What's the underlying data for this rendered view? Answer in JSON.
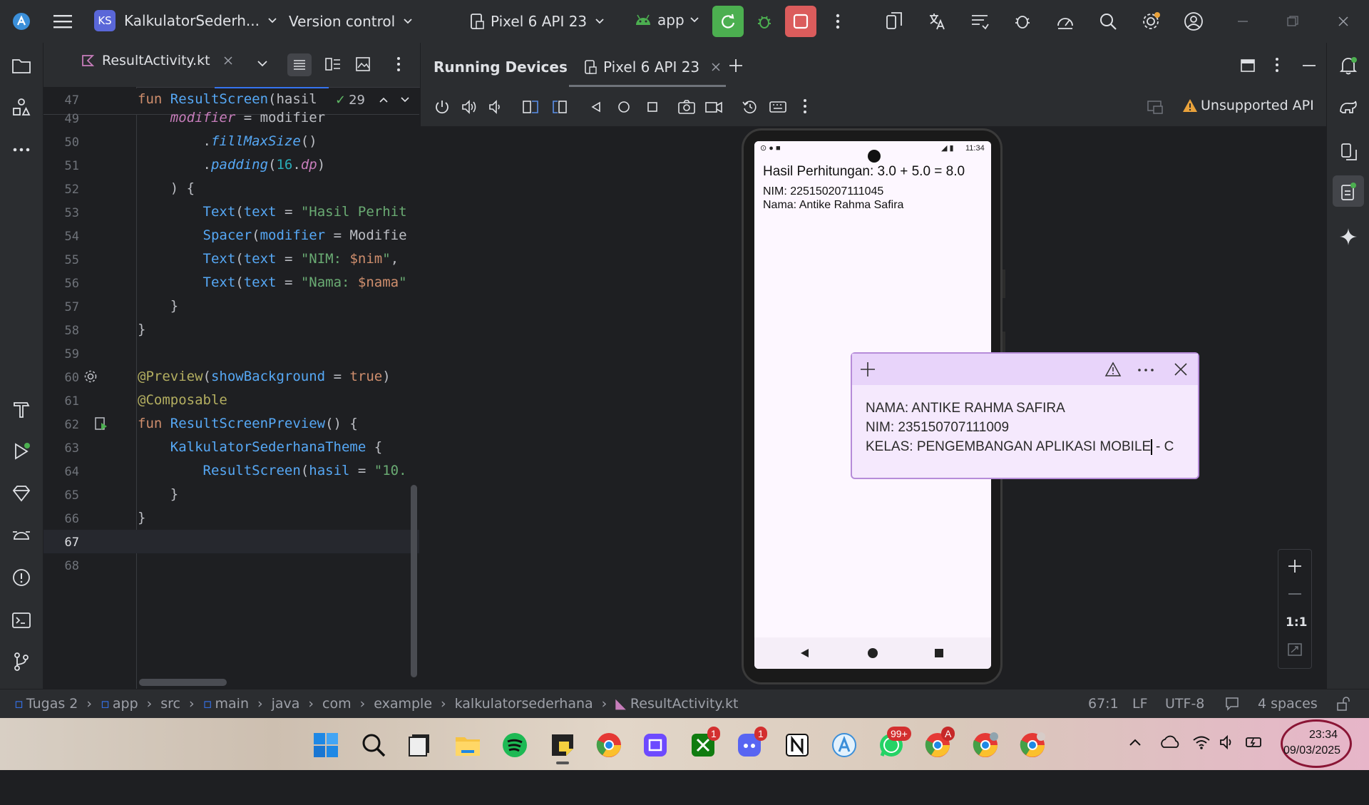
{
  "titlebar": {
    "project_initials": "KS",
    "project_name": "KalkulatorSederh...",
    "version_control": "Version control",
    "device": "Pixel 6 API 23",
    "run_config": "app"
  },
  "editor": {
    "tab_label": "ResultActivity.kt",
    "sticky_header": "fun ResultScreen(hasil",
    "hint_count": "29",
    "lines": [
      {
        "n": "47",
        "text": ""
      },
      {
        "n": "49",
        "text": "modifier = modifier"
      },
      {
        "n": "50",
        "text": ".fillMaxSize()"
      },
      {
        "n": "51",
        "text": ".padding(16.dp)"
      },
      {
        "n": "52",
        "text": ") {"
      },
      {
        "n": "53",
        "text": "Text(text = \"Hasil Perhit"
      },
      {
        "n": "54",
        "text": "Spacer(modifier = Modifie"
      },
      {
        "n": "55",
        "text": "Text(text = \"NIM: $nim\","
      },
      {
        "n": "56",
        "text": "Text(text = \"Nama: $nama\""
      },
      {
        "n": "57",
        "text": "}"
      },
      {
        "n": "58",
        "text": "}"
      },
      {
        "n": "59",
        "text": ""
      },
      {
        "n": "60",
        "text": "@Preview(showBackground = true)"
      },
      {
        "n": "61",
        "text": "@Composable"
      },
      {
        "n": "62",
        "text": "fun ResultScreenPreview() {"
      },
      {
        "n": "63",
        "text": "KalkulatorSederhanaTheme {"
      },
      {
        "n": "64",
        "text": "ResultScreen(hasil = \"10."
      },
      {
        "n": "65",
        "text": "}"
      },
      {
        "n": "66",
        "text": "}"
      },
      {
        "n": "67",
        "text": ""
      },
      {
        "n": "68",
        "text": ""
      }
    ]
  },
  "running_devices": {
    "title": "Running Devices",
    "device_tab": "Pixel 6 API 23",
    "warning": "Unsupported API",
    "zoom_ratio": "1:1"
  },
  "phone": {
    "clock": "11:34",
    "result_line": "Hasil Perhitungan: 3.0 + 5.0 = 8.0",
    "nim_line": "NIM: 225150207111045",
    "nama_line": "Nama: Antike Rahma Safira"
  },
  "sticky_note": {
    "line1": "NAMA: ANTIKE RAHMA SAFIRA",
    "line2": "NIM: 235150707111009",
    "line3_a": "KELAS: PENGEMBANGAN APLIKASI MOBILE",
    "line3_b": " - C"
  },
  "statusbar": {
    "crumbs": [
      "Tugas 2",
      "app",
      "src",
      "main",
      "java",
      "com",
      "example",
      "kalkulatorsederhana",
      "ResultActivity.kt"
    ],
    "position": "67:1",
    "line_ending": "LF",
    "encoding": "UTF-8",
    "indent": "4 spaces"
  },
  "taskbar": {
    "badges": {
      "xbox": "1",
      "discord": "1",
      "whatsapp": "99+",
      "chrome_profile": "A"
    },
    "time": "23:34",
    "date": "09/03/2025"
  },
  "colors": {
    "accent_green": "#4caf50",
    "stop_red": "#db5c5c",
    "note_bg": "#f5e9fd",
    "note_bar": "#e8d4fa"
  }
}
